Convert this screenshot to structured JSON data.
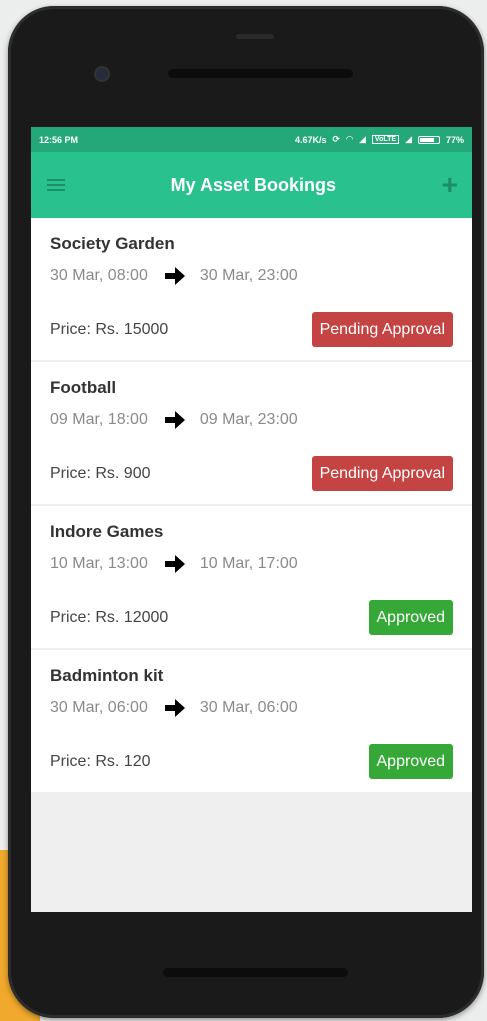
{
  "status_bar": {
    "time": "12:56 PM",
    "speed": "4.67K/s",
    "network": "VoLTE",
    "battery": "77%"
  },
  "app_bar": {
    "title": "My Asset Bookings",
    "menu_icon": "hamburger-menu-icon",
    "add_icon": "plus-icon"
  },
  "colors": {
    "status_bar": "#24a87a",
    "app_bar": "#29c18d",
    "pending": "#c44444",
    "approved": "#36a838"
  },
  "bookings": [
    {
      "name": "Society Garden",
      "from": "30 Mar, 08:00",
      "to": "30 Mar, 23:00",
      "price": "Price: Rs. 15000",
      "status": "Pending Approval"
    },
    {
      "name": "Football",
      "from": "09 Mar, 18:00",
      "to": "09 Mar, 23:00",
      "price": "Price: Rs. 900",
      "status": "Pending Approval"
    },
    {
      "name": "Indore Games",
      "from": "10 Mar, 13:00",
      "to": "10 Mar, 17:00",
      "price": "Price: Rs. 12000",
      "status": "Approved"
    },
    {
      "name": "Badminton kit",
      "from": "30 Mar, 06:00",
      "to": "30 Mar, 06:00",
      "price": "Price: Rs. 120",
      "status": "Approved"
    }
  ]
}
